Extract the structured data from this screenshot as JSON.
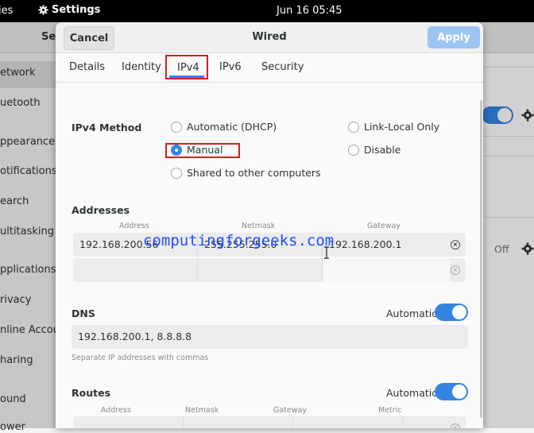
{
  "topbar": {
    "activities": "ies",
    "app": "Settings",
    "clock": "Jun 16  05:45"
  },
  "background": {
    "header_title": "Set",
    "sidebar": [
      "etwork",
      "uetooth",
      "ppearance",
      "otifications",
      "earch",
      "ultitasking",
      "pplications",
      "rivacy",
      "nline Accoun",
      "haring",
      "ound",
      "ower"
    ],
    "off_label": "Off"
  },
  "dialog": {
    "cancel": "Cancel",
    "title": "Wired",
    "apply": "Apply",
    "tabs": [
      "Details",
      "Identity",
      "IPv4",
      "IPv6",
      "Security"
    ],
    "method_label": "IPv4 Method",
    "methods": {
      "auto": "Automatic (DHCP)",
      "link_local": "Link-Local Only",
      "manual": "Manual",
      "disable": "Disable",
      "shared": "Shared to other computers"
    },
    "addresses": {
      "title": "Addresses",
      "headers": [
        "Address",
        "Netmask",
        "Gateway"
      ],
      "rows": [
        {
          "address": "192.168.200.56",
          "netmask": "255.255.255.0",
          "gateway": "192.168.200.1"
        },
        {
          "address": "",
          "netmask": "",
          "gateway": ""
        }
      ]
    },
    "dns": {
      "title": "DNS",
      "automatic_label": "Automatic",
      "automatic_on": true,
      "value": "192.168.200.1, 8.8.8.8",
      "hint": "Separate IP addresses with commas"
    },
    "routes": {
      "title": "Routes",
      "automatic_label": "Automatic",
      "automatic_on": true,
      "headers": [
        "Address",
        "Netmask",
        "Gateway",
        "Metric"
      ]
    }
  },
  "watermark": "computingforgeeks.com",
  "colors": {
    "accent": "#3584e4",
    "highlight": "#d11f1f",
    "watermark": "#1e50ff"
  }
}
